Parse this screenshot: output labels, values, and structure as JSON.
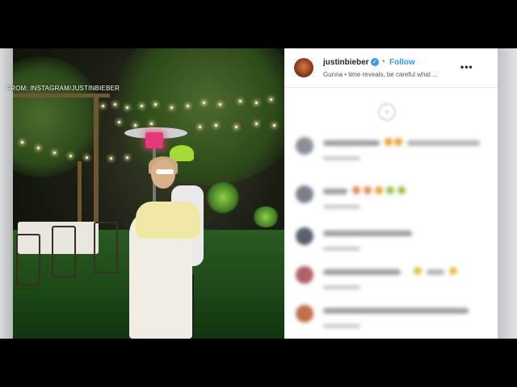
{
  "watermark": "FROM: INSTAGRAM/JUSTINBIEBER",
  "post": {
    "username": "justinbieber",
    "verified_icon": "verified-badge-icon",
    "separator": "•",
    "follow_label": "Follow",
    "caption": "Gunna • time reveals, be careful what ...",
    "more_icon": "•••",
    "add_comment_icon": "+"
  },
  "colors": {
    "follow_accent": "#3897f0",
    "hat": "#a4dc36",
    "heater_glow": "#e33a7a"
  },
  "comments": [
    {
      "avatar_color": "#8a8f99"
    },
    {
      "avatar_color": "#7a7f8a"
    },
    {
      "avatar_color": "#5a6070"
    },
    {
      "avatar_color": "#b0606a"
    },
    {
      "avatar_color": "#c0704a"
    }
  ]
}
